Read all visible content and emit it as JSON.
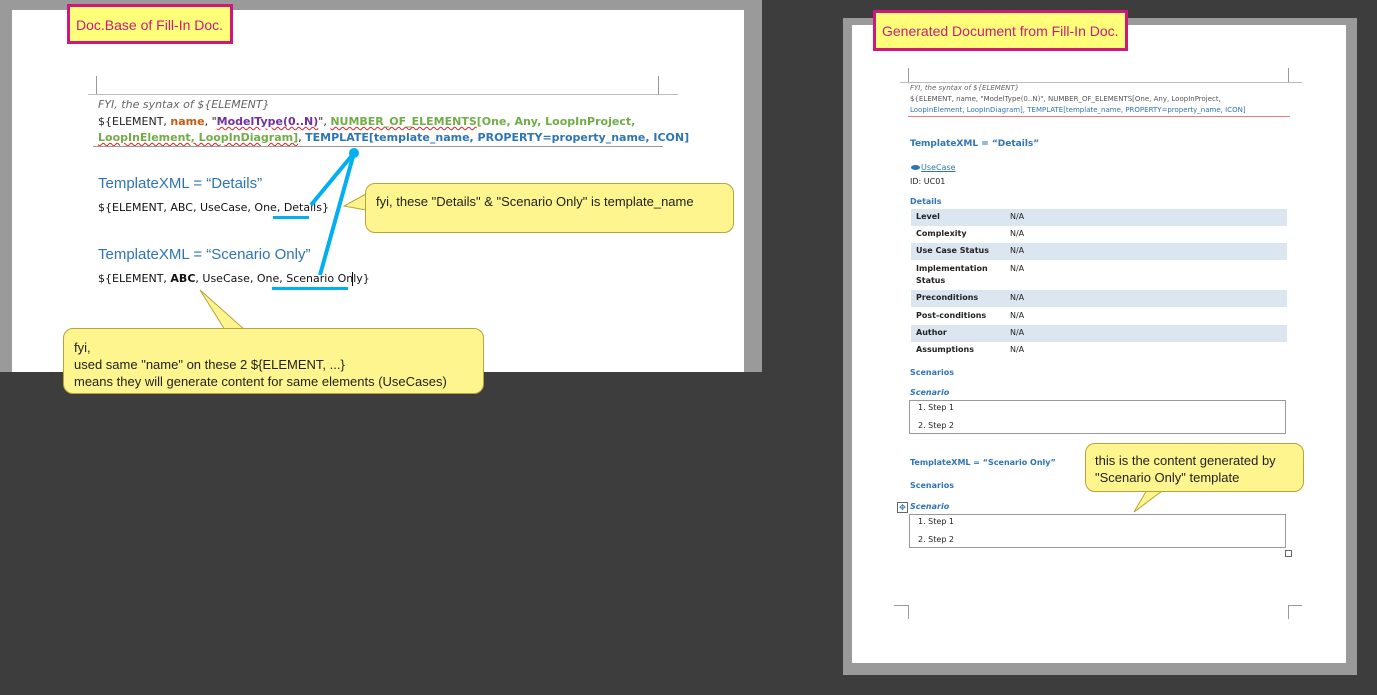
{
  "left_doc": {
    "tag": "Doc.Base of Fill-In Doc.",
    "syntax_caption": "FYI, the syntax of ${ELEMENT}",
    "syntax_line1": {
      "p1": "${ELEMENT, ",
      "p2": "name",
      "p3": ", \"",
      "p4": "ModelType(0..N)",
      "p5": "\", ",
      "p6": "NUMBER_OF_ELEMENTS",
      "p7": "[One, Any, LoopInProject,"
    },
    "syntax_line2": {
      "p1": "LoopInElement, LoopInDiagram]",
      "p2": ", ",
      "p3": "TEMPLATE[template_name, PROPERTY=property_name, ICON]"
    },
    "heading_details": "TemplateXML = “Details”",
    "line_details": "${ELEMENT,  ABC, UseCase, One, Details}",
    "heading_scenario": "TemplateXML = “Scenario Only”",
    "line_scenario_prefix": "${ELEMENT,  ",
    "line_scenario_abc": "ABC",
    "line_scenario_rest": ", UseCase, One, Scenario Only}",
    "callout_template": "fyi, these \"Details\" & \"Scenario Only\"  is  template_name",
    "callout_name_l1": "fyi,",
    "callout_name_l2": "used same \"name\" on these 2 ${ELEMENT, ...}",
    "callout_name_l3": "means they will generate content for same elements (UseCases)"
  },
  "right_doc": {
    "tag": "Generated Document from Fill-In Doc.",
    "syntax_caption": "FYI, the syntax of ${ELEMENT}",
    "syntax_line1": "${ELEMENT, name, \"ModelType(0..N)\", NUMBER_OF_ELEMENTS[One, Any, LoopInProject,",
    "syntax_line2": "LoopInElement, LoopInDiagram], TEMPLATE[template_name, PROPERTY=property_name, ICON]",
    "heading_details": "TemplateXML = “Details”",
    "usecase_link": "UseCase",
    "id_line": "ID: UC01",
    "details_label": "Details",
    "rows": [
      {
        "k": "Level",
        "v": "N/A"
      },
      {
        "k": "Complexity",
        "v": "N/A"
      },
      {
        "k": "Use Case Status",
        "v": "N/A"
      },
      {
        "k": "Implementation",
        "v": "N/A"
      },
      {
        "k": "Status",
        "v": ""
      },
      {
        "k": "Preconditions",
        "v": "N/A"
      },
      {
        "k": "Post-conditions",
        "v": "N/A"
      },
      {
        "k": "Author",
        "v": "N/A"
      },
      {
        "k": "Assumptions",
        "v": "N/A"
      }
    ],
    "scenarios_label": "Scenarios",
    "scenario_label": "Scenario",
    "step1": "1. Step 1",
    "step2": "2. Step 2",
    "heading_scenario": "TemplateXML = “Scenario Only”",
    "scenarios_label2": "Scenarios",
    "scenario_label2": "Scenario",
    "step1b": "1. Step 1",
    "step2b": "2. Step 2",
    "callout": "this is the content generated by \"Scenario Only\" template"
  },
  "colors": {
    "accent_blue": "#2e74b5",
    "callout_fill": "#fff58e",
    "tag_border": "#d0187c",
    "link_blue": "#00b0f0"
  }
}
